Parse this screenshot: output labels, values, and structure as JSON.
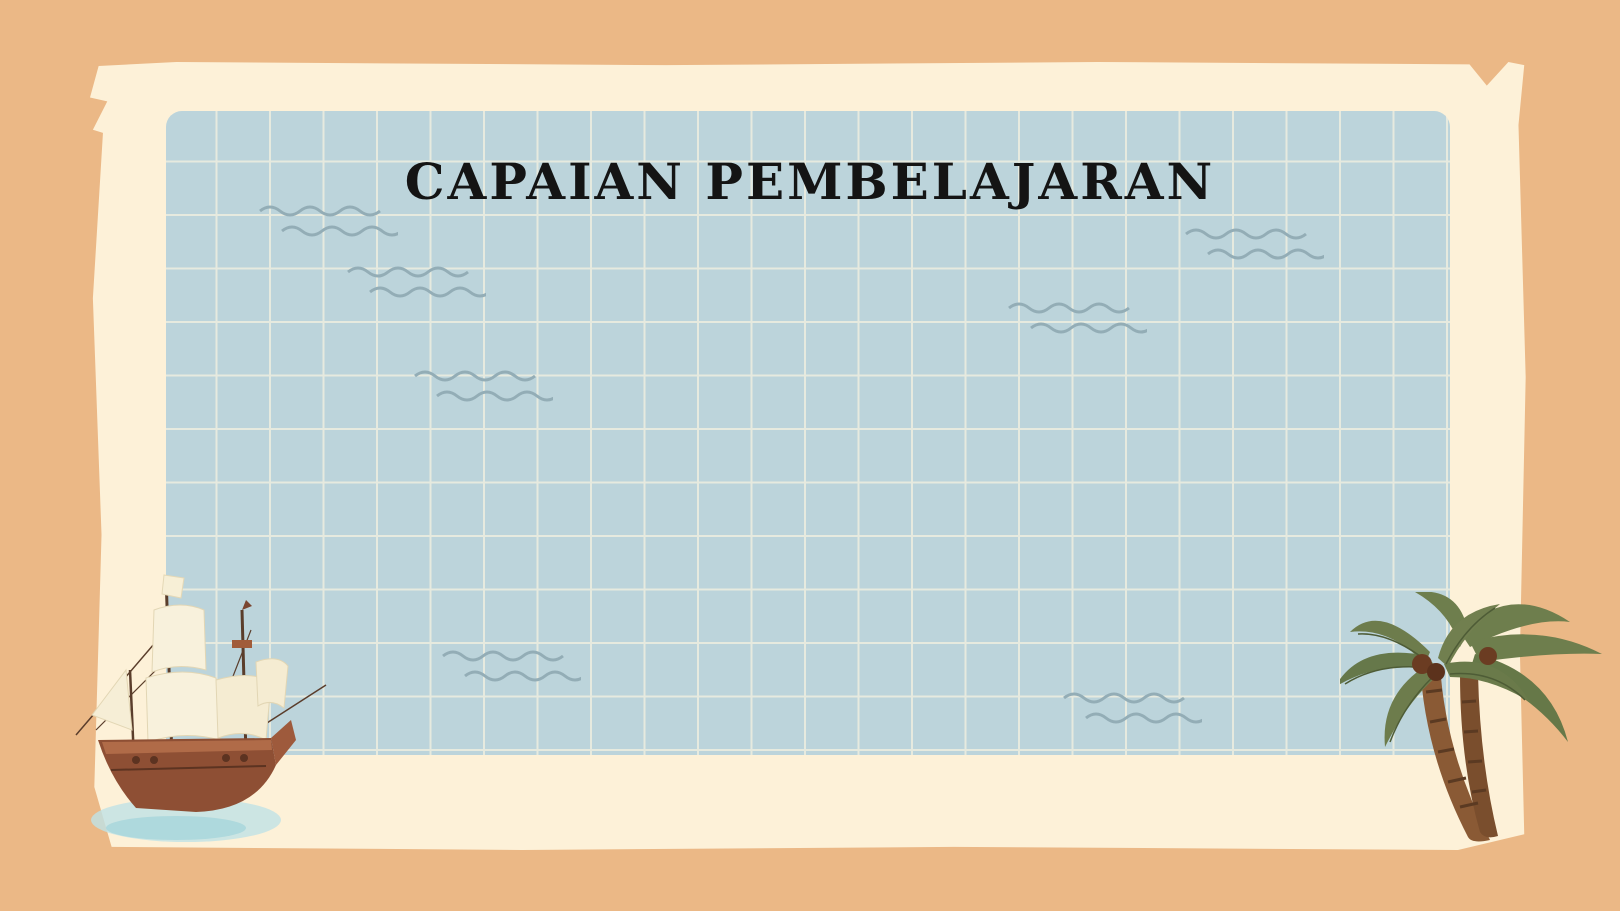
{
  "slide": {
    "title": "CAPAIAN PEMBELAJARAN"
  },
  "colors": {
    "background": "#ebb886",
    "paper": "#fdf1d8",
    "map": "#bcd4db",
    "grid": "#e6eadf",
    "waves": "#93adb6",
    "title": "#141414"
  },
  "icons": {
    "ship": "sailing-ship-icon",
    "palm": "palm-tree-icon",
    "waves": "wave-icon"
  }
}
